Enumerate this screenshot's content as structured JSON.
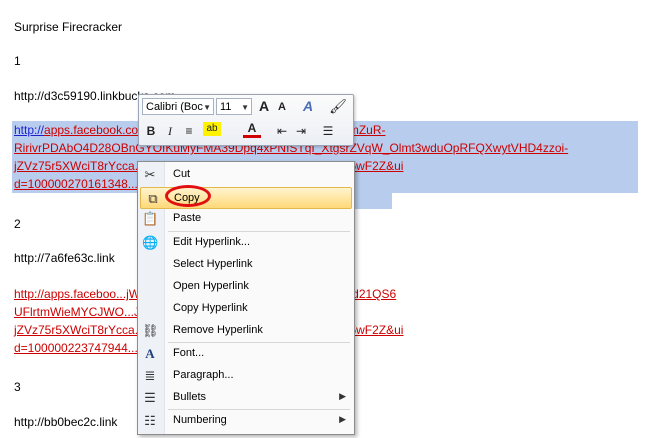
{
  "document": {
    "title": "Surprise Firecracker",
    "n1": "1",
    "url1": "http://d3c59190.linkbucks.com",
    "link1_part1": "http://",
    "link1_line1": "apps.facebook.com/...uGg-x0Up-W7U2Q55T5NIAb-PfXHmZuR-",
    "link1_line2": "RirivrPDAbO4D28OBnGYOIKuMyFMA39Dpq4xPNISTqI_XtgsrZVqW_Olmt3wduOpRFQXwytVHD4zzoi-",
    "link1_line3": "jZVz75r5XWciT8rYcca...uOpRFQXwytVHDb1To4F4Y2vk_tgxi05wF2Z&ui",
    "link1_line4": "d=100000270161348...e=ins",
    "n2": "2",
    "url2": "http://7a6fe63c.link",
    "link2_line1": "http://apps.faceboo...jWNFVbcqrndzR22OcizgaKSFYcCHAnOTd21QS6",
    "link2_line2": "UFlrtmWieMYCJWO...J_Olmt3wduOpRFQXwytVHD4zzoi-",
    "link2_line3": "jZVz75r5XWciT8rYcca...uOpRFQXwytVHDb1To4F4Y2vk_tgxi05wF2Z&ui",
    "link2_line4": "d=100000223747944...e=ins",
    "n3": "3",
    "url3": "http://bb0bec2c.link"
  },
  "mini_toolbar": {
    "font": "Calibri (Boc",
    "size": "11",
    "grow_font": "A",
    "shrink_font": "A",
    "styles": "A",
    "bold": "B",
    "italic": "I",
    "center": "≡",
    "highlight": "ab",
    "font_color": "A",
    "indent_dec": "⇤",
    "indent_inc": "⇥",
    "bullets": "☰"
  },
  "context_menu": {
    "items": [
      {
        "label": "Cut",
        "icon": "scissors-icon"
      },
      {
        "label": "Copy",
        "icon": "copy-icon"
      },
      {
        "label": "Paste",
        "icon": "paste-icon"
      },
      {
        "label": "Edit Hyperlink...",
        "icon": "globe-icon"
      },
      {
        "label": "Select Hyperlink",
        "icon": ""
      },
      {
        "label": "Open Hyperlink",
        "icon": ""
      },
      {
        "label": "Copy Hyperlink",
        "icon": ""
      },
      {
        "label": "Remove Hyperlink",
        "icon": "unlink-icon"
      },
      {
        "label": "Font...",
        "icon": "font-icon"
      },
      {
        "label": "Paragraph...",
        "icon": "paragraph-icon"
      },
      {
        "label": "Bullets",
        "icon": "bullets-icon"
      },
      {
        "label": "Numbering",
        "icon": "numbering-icon"
      }
    ],
    "highlighted": "Copy"
  },
  "colors": {
    "link_blue": "#1f1fd0",
    "link_red": "#cc0000",
    "selection": "#b8cdee",
    "highlight": "#ffd979",
    "annotation_ring": "#e01010"
  }
}
